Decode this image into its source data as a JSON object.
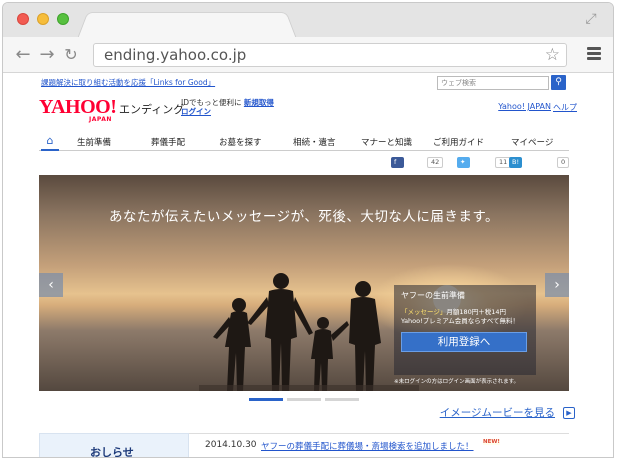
{
  "browser": {
    "url": "ending.yahoo.co.jp"
  },
  "top_bar": {
    "campaign_link": "課題解決に取り組む活動を応援「Links for Good」",
    "search_placeholder": "ウェブ検索"
  },
  "header": {
    "logo_text": "YAHOO!",
    "logo_sub": "JAPAN",
    "service_name": "エンディング",
    "login_prompt": "IDでもっと便利に",
    "register_link": "新規取得",
    "login_link": "ログイン",
    "yahoo_japan_link": "Yahoo! JAPAN",
    "help_link": "ヘルプ"
  },
  "global_nav": {
    "items": [
      {
        "label": "生前準備"
      },
      {
        "label": "葬儀手配"
      },
      {
        "label": "お墓を探す"
      },
      {
        "label": "相続・遺言"
      },
      {
        "label": "マナーと知識"
      },
      {
        "label": "ご利用ガイド"
      },
      {
        "label": "マイページ"
      }
    ]
  },
  "social": {
    "share_label": "シェア",
    "share_count": "42",
    "tweet_label": "ツイート",
    "tweet_count": "11",
    "bookmark_label": "ブックマーク",
    "bookmark_count": "0"
  },
  "hero": {
    "title": "あなたが伝えたいメッセージが、死後、大切な人に届きます。",
    "promo_title": "ヤフーの生前準備",
    "promo_line1_a": "「メッセージ」",
    "promo_line1_b": "月額180円＋税14円",
    "promo_line2": "Yahoo!プレミアム会員ならすべて無料！",
    "promo_button": "利用登録へ",
    "promo_note": "※未ログインの方はログイン画面が表示されます。"
  },
  "image_movie_link": "イメージムービーを見る",
  "news": {
    "label": "おしらせ",
    "date": "2014.10.30",
    "headline": "ヤフーの葬儀手配に葬儀場・斎場検索を追加しました！",
    "badge": "NEW!"
  },
  "colors": {
    "yahoo_red": "#ff0033",
    "accent_blue": "#2a63c9",
    "link_blue": "#2255cc"
  }
}
